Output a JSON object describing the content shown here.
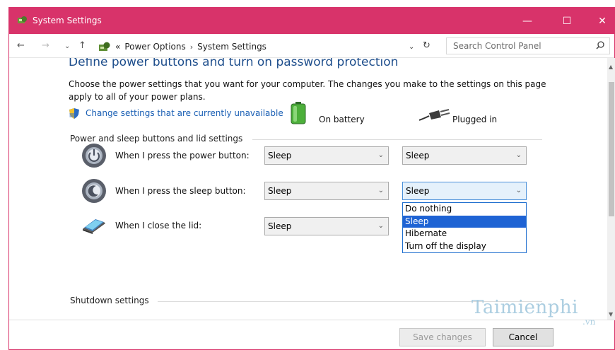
{
  "window": {
    "title": "System Settings",
    "accent": "#d8336a"
  },
  "titlebar": {
    "minimize": "—",
    "maximize": "☐",
    "close": "✕"
  },
  "nav": {
    "back": "←",
    "forward": "→",
    "recent": "⌄",
    "up": "↑"
  },
  "breadcrumb": {
    "overflow": "«",
    "items": [
      "Power Options",
      "System Settings"
    ],
    "separator": "›"
  },
  "address": {
    "dropdown": "⌄",
    "refresh": "↻"
  },
  "search": {
    "placeholder": "Search Control Panel"
  },
  "main": {
    "heading": "Define power buttons and turn on password protection",
    "description": "Choose the power settings that you want for your computer. The changes you make to the settings on this page apply to all of your power plans.",
    "change_link": "Change settings that are currently unavailable",
    "section_power": "Power and sleep buttons and lid settings",
    "section_shutdown": "Shutdown settings",
    "col_battery": "On battery",
    "col_plugged": "Plugged in",
    "rows": [
      {
        "label": "When I press the power button:",
        "battery": "Sleep",
        "plugged": "Sleep"
      },
      {
        "label": "When I press the sleep button:",
        "battery": "Sleep",
        "plugged": "Sleep"
      },
      {
        "label": "When I close the lid:",
        "battery": "Sleep"
      }
    ],
    "dropdown_options": [
      "Do nothing",
      "Sleep",
      "Hibernate",
      "Turn off the display"
    ],
    "dropdown_selected": "Sleep"
  },
  "footer": {
    "save": "Save changes",
    "cancel": "Cancel"
  },
  "watermark": {
    "text": "Taimienphi",
    "sub": ".vn"
  },
  "colors": {
    "link": "#1a5fb4",
    "heading": "#1e4e8c",
    "selection": "#1e63d4"
  }
}
